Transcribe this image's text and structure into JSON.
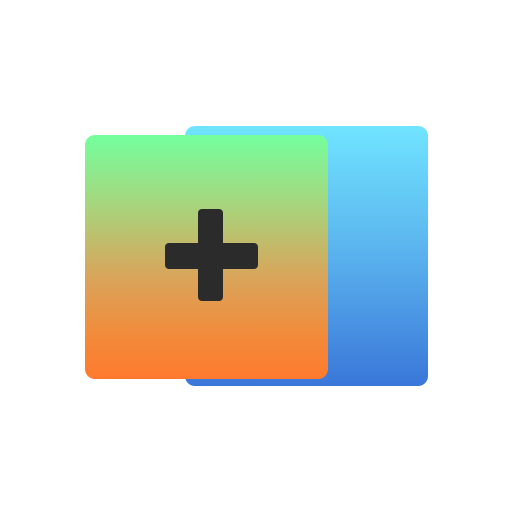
{
  "icon": {
    "name": "add-to-stack-icon",
    "colors": {
      "back_card_top": "#70e4ff",
      "back_card_bottom": "#3a77d9",
      "front_card_top": "#74ff9e",
      "front_card_bottom": "#ff7a2e",
      "plus": "#2b2b2b",
      "background": "#ffffff"
    }
  }
}
